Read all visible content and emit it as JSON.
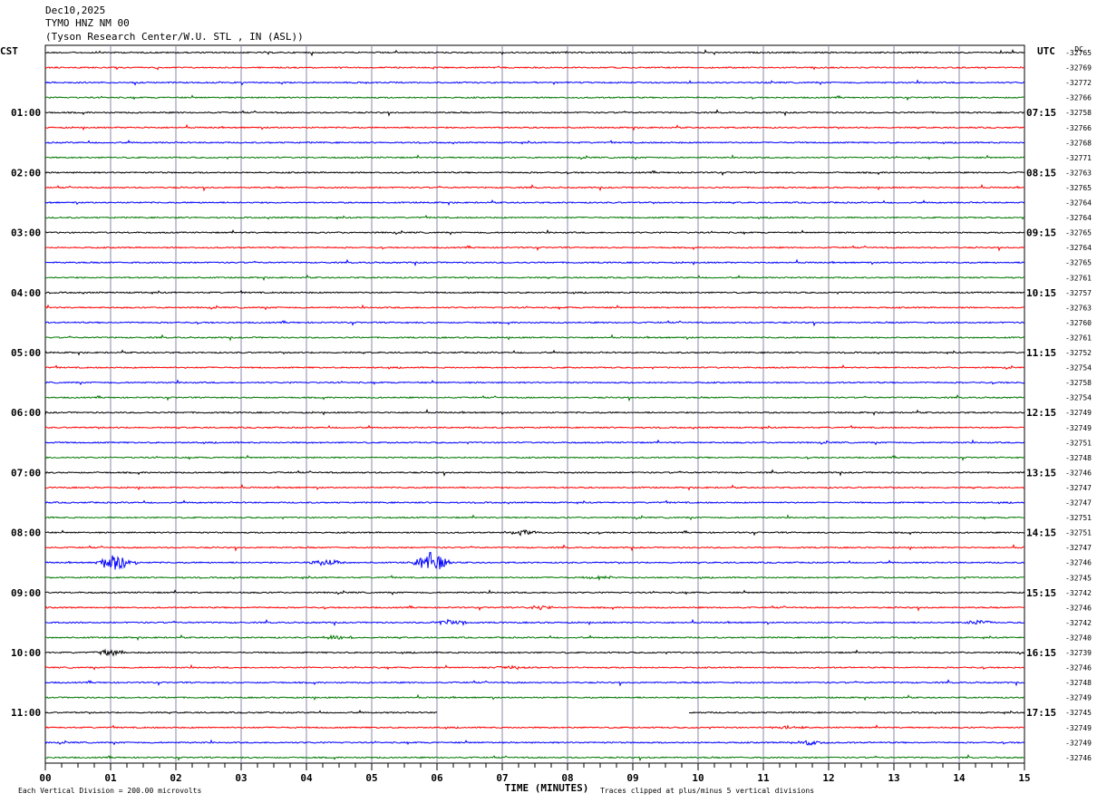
{
  "header": {
    "date": "Dec10,2025",
    "station": "TYMO HNZ NM 00",
    "location": "(Tyson Research Center/W.U. STL , IN (ASL))"
  },
  "chart_data": {
    "type": "line",
    "left_zone_label": "CST",
    "right_zone_label": "UTC",
    "dc_label": "DC",
    "xlabel": "TIME (MINUTES)",
    "xlim": [
      0,
      15
    ],
    "x_ticks": [
      "00",
      "01",
      "02",
      "03",
      "04",
      "05",
      "06",
      "07",
      "08",
      "09",
      "10",
      "11",
      "12",
      "13",
      "14",
      "15"
    ],
    "scale_note": "Each Vertical Division =  200.00 microvolts",
    "clip_note": "Traces clipped at plus/minus 5 vertical divisions",
    "trace_colors": [
      "#000000",
      "#ff0000",
      "#0000ff",
      "#007700"
    ],
    "left_hour_labels": [
      "01:00",
      "02:00",
      "03:00",
      "04:00",
      "05:00",
      "06:00",
      "07:00",
      "08:00",
      "09:00",
      "10:00",
      "11:00"
    ],
    "right_hour_labels": [
      "07:15",
      "08:15",
      "09:15",
      "10:15",
      "11:15",
      "12:15",
      "13:15",
      "14:15",
      "15:15",
      "16:15",
      "17:15"
    ],
    "dc_offsets": [
      "-32765",
      "-32769",
      "-32772",
      "-32766",
      "-32758",
      "-32766",
      "-32768",
      "-32771",
      "-32763",
      "-32765",
      "-32764",
      "-32764",
      "-32765",
      "-32764",
      "-32765",
      "-32761",
      "-32757",
      "-32763",
      "-32760",
      "-32761",
      "-32752",
      "-32754",
      "-32758",
      "-32754",
      "-32749",
      "-32749",
      "-32751",
      "-32748",
      "-32746",
      "-32747",
      "-32747",
      "-32751",
      "-32751",
      "-32747",
      "-32746",
      "-32745",
      "-32742",
      "-32746",
      "-32742",
      "-32740",
      "-32739",
      "-32746",
      "-32748",
      "-32749",
      "-32745",
      "-32749",
      "-32749",
      "-32746"
    ],
    "events": [
      {
        "trace": 32,
        "minute": 7.3,
        "amp": 2.5
      },
      {
        "trace": 34,
        "minute": 1.1,
        "amp": 10
      },
      {
        "trace": 34,
        "minute": 4.3,
        "amp": 4
      },
      {
        "trace": 34,
        "minute": 5.9,
        "amp": 12
      },
      {
        "trace": 35,
        "minute": 8.5,
        "amp": 2
      },
      {
        "trace": 37,
        "minute": 7.6,
        "amp": 2
      },
      {
        "trace": 38,
        "minute": 6.2,
        "amp": 3
      },
      {
        "trace": 38,
        "minute": 14.3,
        "amp": 2.5
      },
      {
        "trace": 39,
        "minute": 4.5,
        "amp": 2.5
      },
      {
        "trace": 40,
        "minute": 1.0,
        "amp": 3
      },
      {
        "trace": 41,
        "minute": 7.1,
        "amp": 2
      },
      {
        "trace": 45,
        "minute": 11.4,
        "amp": 2
      },
      {
        "trace": 46,
        "minute": 11.7,
        "amp": 2.5
      }
    ],
    "gap": {
      "trace": 44,
      "from_minute": 6.0,
      "to_minute": 9.85
    }
  }
}
